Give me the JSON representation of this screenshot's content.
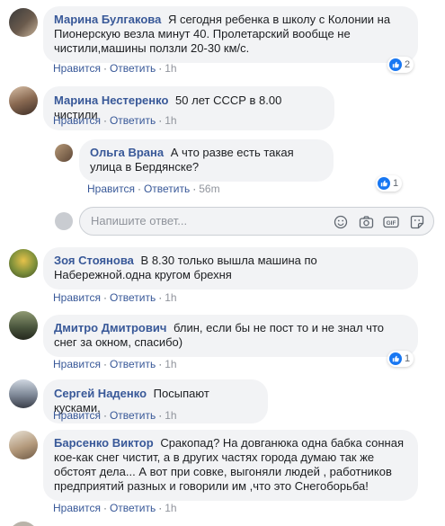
{
  "comments": [
    {
      "author": "Марина Булгакова",
      "text": "Я сегодня ребенка в школу с Колонии на Пионерскую везла минут 40. Пролетарский вообще не чистили,машины ползли 20-30 км/с.",
      "like_label": "Нравится",
      "reply_label": "Ответить",
      "time": "1h",
      "likes": "2"
    },
    {
      "author": "Марина Нестеренко",
      "text": "50 лет СССР в 8.00 чистили",
      "like_label": "Нравится",
      "reply_label": "Ответить",
      "time": "1h"
    },
    {
      "author": "Ольга Врана",
      "text": "А что разве есть такая улица в Бердянске?",
      "like_label": "Нравится",
      "reply_label": "Ответить",
      "time": "56m",
      "likes": "1"
    },
    {
      "author": "Зоя Стоянова",
      "text": "В 8.30 только вышла машина по Набережной.одна кругом брехня",
      "like_label": "Нравится",
      "reply_label": "Ответить",
      "time": "1h"
    },
    {
      "author": "Дмитро Дмитрович",
      "text": "блин, если бы не пост то и не знал что снег за окном, спасибо)",
      "like_label": "Нравится",
      "reply_label": "Ответить",
      "time": "1h",
      "likes": "1"
    },
    {
      "author": "Сергей Наденко",
      "text": "Посыпают кусками,",
      "like_label": "Нравится",
      "reply_label": "Ответить",
      "time": "1h"
    },
    {
      "author": "Барсенко Виктор",
      "text": "Сракопад? На довганюка одна бабка сонная кое-как снег чистит, а в других частях города думаю так же обстоят дела... А вот при совке, выгоняли людей , работников предприятий разных и говорили им ,что это Снегоборьба!",
      "like_label": "Нравится",
      "reply_label": "Ответить",
      "time": "1h"
    }
  ],
  "reply_input": {
    "placeholder": "Напишите ответ..."
  },
  "colors": {
    "link": "#385898",
    "bubble": "#f2f3f5",
    "like_blue": "#1877f2"
  }
}
